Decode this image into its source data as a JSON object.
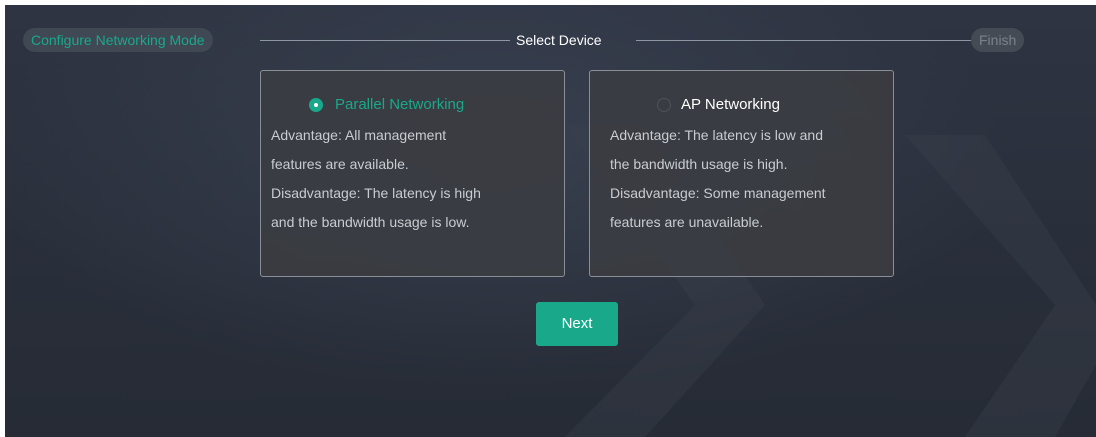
{
  "steps": [
    {
      "label": "Configure Networking Mode",
      "state": "done"
    },
    {
      "label": "Select Device",
      "state": "current"
    },
    {
      "label": "Finish",
      "state": "pending"
    }
  ],
  "options": {
    "parallel": {
      "title": "Parallel Networking",
      "selected": true,
      "lines": [
        "Advantage: All management",
        "features are available.",
        "Disadvantage: The latency is high",
        "and the bandwidth usage is low."
      ]
    },
    "ap": {
      "title": "AP Networking",
      "selected": false,
      "lines": [
        "Advantage: The latency is low and",
        "the bandwidth usage is high.",
        "Disadvantage: Some management",
        "features are unavailable."
      ]
    }
  },
  "next_button": {
    "label": "Next"
  },
  "colors": {
    "accent": "#19a98a",
    "background": "#2a303c",
    "card": "#3a3c42"
  }
}
